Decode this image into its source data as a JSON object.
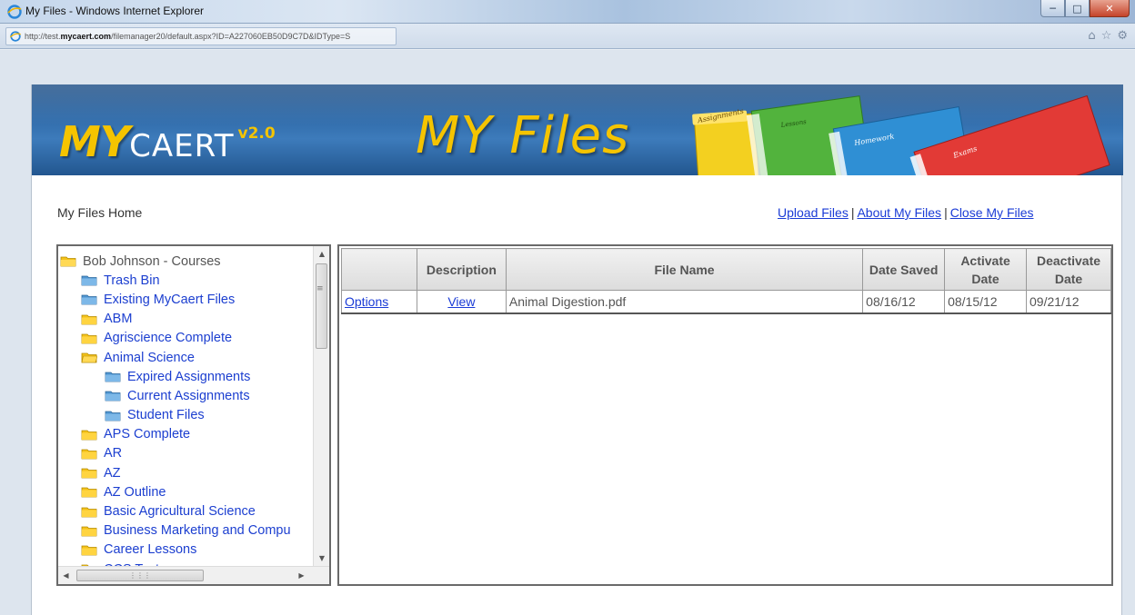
{
  "window": {
    "title": "My Files - Windows Internet Explorer",
    "url_prefix": "http://test.",
    "url_domain": "mycaert.com",
    "url_path": "/filemanager20/default.aspx?ID=A227060EB50D9C7D&IDType=S",
    "minimize_icon": "minimize-icon",
    "maximize_icon": "maximize-icon",
    "close_icon": "close-icon"
  },
  "banner": {
    "logo_my": "MY",
    "logo_caert": "CAERT",
    "logo_version": "v2.0",
    "title": "MY Files",
    "book_labels": [
      "Assignments",
      "Lessons",
      "Homework",
      "Exams"
    ]
  },
  "header": {
    "home_label": "My Files Home",
    "links": {
      "upload": "Upload Files",
      "about": "About My Files",
      "close": "Close My Files",
      "separator": "|"
    }
  },
  "tree": {
    "root": "Bob Johnson - Courses",
    "items": [
      {
        "label": "Trash Bin",
        "level": 1,
        "icon": "folder-blue-icon"
      },
      {
        "label": "Existing MyCaert Files",
        "level": 1,
        "icon": "folder-blue-icon"
      },
      {
        "label": "ABM",
        "level": 1,
        "icon": "folder-yellow-icon"
      },
      {
        "label": "Agriscience Complete",
        "level": 1,
        "icon": "folder-yellow-icon"
      },
      {
        "label": "Animal Science",
        "level": 1,
        "icon": "folder-open-icon"
      },
      {
        "label": "Expired Assignments",
        "level": 2,
        "icon": "folder-blue-icon"
      },
      {
        "label": "Current Assignments",
        "level": 2,
        "icon": "folder-blue-icon"
      },
      {
        "label": "Student Files",
        "level": 2,
        "icon": "folder-blue-icon"
      },
      {
        "label": "APS Complete",
        "level": 1,
        "icon": "folder-yellow-icon"
      },
      {
        "label": "AR",
        "level": 1,
        "icon": "folder-yellow-icon"
      },
      {
        "label": "AZ",
        "level": 1,
        "icon": "folder-yellow-icon"
      },
      {
        "label": "AZ Outline",
        "level": 1,
        "icon": "folder-yellow-icon"
      },
      {
        "label": "Basic Agricultural Science",
        "level": 1,
        "icon": "folder-yellow-icon"
      },
      {
        "label": "Business Marketing and Compu",
        "level": 1,
        "icon": "folder-yellow-icon"
      },
      {
        "label": "Career Lessons",
        "level": 1,
        "icon": "folder-yellow-icon"
      },
      {
        "label": "CCS Test",
        "level": 1,
        "icon": "folder-yellow-icon"
      }
    ]
  },
  "files_table": {
    "columns": [
      "",
      "Description",
      "File Name",
      "Date Saved",
      "Activate Date",
      "Deactivate Date"
    ],
    "rows": [
      {
        "options": "Options",
        "description": "View",
        "file_name": "Animal Digestion.pdf",
        "date_saved": "08/16/12",
        "activate_date": "08/15/12",
        "deactivate_date": "09/21/12"
      }
    ]
  },
  "colors": {
    "banner_blue": "#2f6aa8",
    "logo_yellow": "#f5c400",
    "link_blue": "#1a3bd6",
    "folder_yellow": "#f4c21a",
    "folder_blue": "#5ea3dc"
  }
}
